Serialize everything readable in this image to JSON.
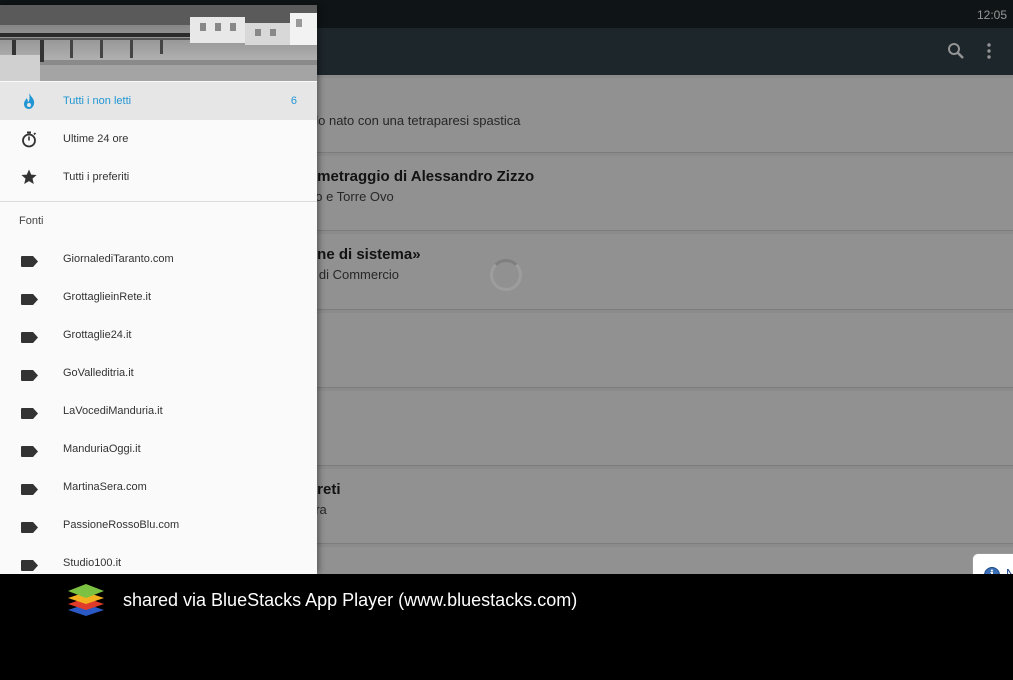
{
  "status_bar": {
    "time": "12:05"
  },
  "app_bar": {
    "search_icon": "search-icon",
    "overflow_icon": "more-vert-icon"
  },
  "articles": [
    {
      "title": "",
      "subtitle": "",
      "single": "olo nato con una tetraparesi spastica"
    },
    {
      "title": "ometraggio di Alessandro Zizzo",
      "subtitle": "no e Torre Ovo"
    },
    {
      "title": "one di sistema»",
      "subtitle": "a di Commercio"
    },
    {
      "title": "",
      "subtitle": ""
    },
    {
      "title": "",
      "subtitle": ""
    },
    {
      "title": "oreti",
      "subtitle": "era"
    }
  ],
  "drawer": {
    "main_items": [
      {
        "label": "Tutti i non letti",
        "count": "6",
        "icon": "fire-icon"
      },
      {
        "label": "Ultime 24 ore",
        "icon": "stopwatch-icon"
      },
      {
        "label": "Tutti i preferiti",
        "icon": "star-icon"
      }
    ],
    "section_title": "Fonti",
    "sources": [
      "GiornalediTaranto.com",
      "GrottaglieinRete.it",
      "Grottaglie24.it",
      "GoValleditria.it",
      "LaVocediManduria.it",
      "ManduriaOggi.it",
      "MartinaSera.com",
      "PassioneRossoBlu.com",
      "Studio100.it"
    ]
  },
  "toast": {
    "text": "N"
  },
  "footer": {
    "text": "shared via BlueStacks App Player (www.bluestacks.com)"
  },
  "colors": {
    "accent": "#2196d3",
    "app_bar": "#33434a",
    "status_bar": "#1a2326"
  }
}
